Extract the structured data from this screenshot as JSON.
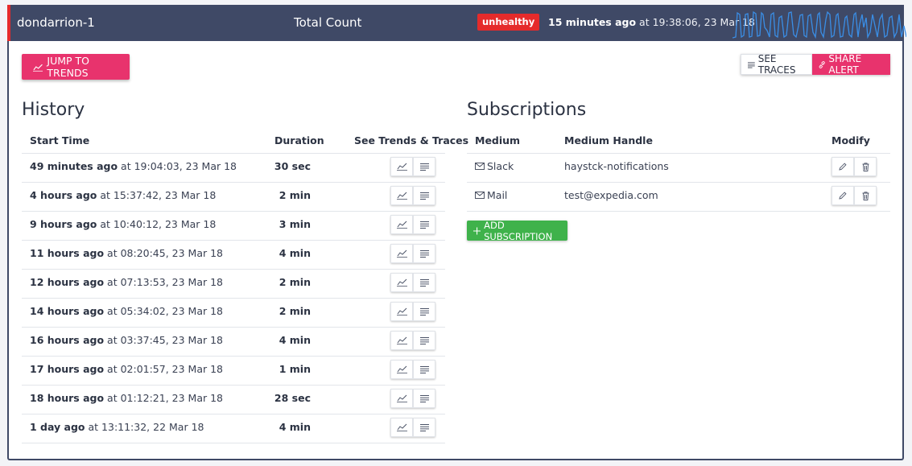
{
  "header": {
    "alert_name": "dondarrion-1",
    "metric": "Total Count",
    "status": "unhealthy",
    "time_relative": "15 minutes ago",
    "time_absolute": " at 19:38:06, 23 Mar 18",
    "colors": {
      "bar": "#3f4966",
      "status": "#e52b2b",
      "sparkline": "#3a8ee6"
    }
  },
  "toolbar": {
    "jump_label": "JUMP TO TRENDS",
    "see_traces_label": "SEE TRACES",
    "share_alert_label": "SHARE ALERT",
    "accent": "#e8336d"
  },
  "history": {
    "title": "History",
    "columns": [
      "Start Time",
      "Duration",
      "See Trends & Traces"
    ],
    "rows": [
      {
        "relative": "49 minutes ago",
        "absolute": " at 19:04:03, 23 Mar 18",
        "duration": "30 sec"
      },
      {
        "relative": "4 hours ago",
        "absolute": " at 15:37:42, 23 Mar 18",
        "duration": "2 min"
      },
      {
        "relative": "9 hours ago",
        "absolute": " at 10:40:12, 23 Mar 18",
        "duration": "3 min"
      },
      {
        "relative": "11 hours ago",
        "absolute": " at 08:20:45, 23 Mar 18",
        "duration": "4 min"
      },
      {
        "relative": "12 hours ago",
        "absolute": " at 07:13:53, 23 Mar 18",
        "duration": "2 min"
      },
      {
        "relative": "14 hours ago",
        "absolute": " at 05:34:02, 23 Mar 18",
        "duration": "2 min"
      },
      {
        "relative": "16 hours ago",
        "absolute": " at 03:37:45, 23 Mar 18",
        "duration": "4 min"
      },
      {
        "relative": "17 hours ago",
        "absolute": " at 02:01:57, 23 Mar 18",
        "duration": "1 min"
      },
      {
        "relative": "18 hours ago",
        "absolute": " at 01:12:21, 23 Mar 18",
        "duration": "28 sec"
      },
      {
        "relative": "1 day ago",
        "absolute": " at 13:11:32, 22 Mar 18",
        "duration": "4 min"
      }
    ],
    "icons": [
      "trends-icon",
      "traces-icon"
    ]
  },
  "subscriptions": {
    "title": "Subscriptions",
    "columns": [
      "Medium",
      "Medium Handle",
      "Modify"
    ],
    "rows": [
      {
        "medium": "Slack",
        "handle": "haystck-notifications"
      },
      {
        "medium": "Mail",
        "handle": "test@expedia.com"
      }
    ],
    "add_label": "ADD SUBSCRIPTION",
    "add_color": "#3fb24b",
    "icons": [
      "envelope-icon",
      "pencil-icon",
      "trash-icon"
    ]
  }
}
